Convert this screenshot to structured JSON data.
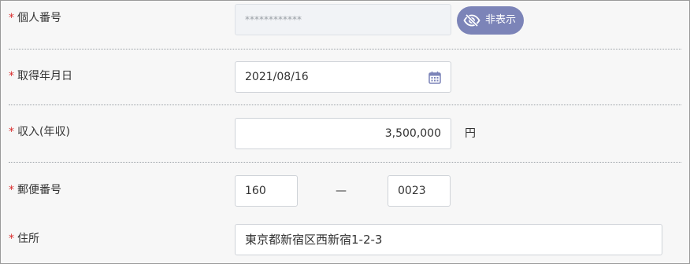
{
  "form": {
    "my_number": {
      "required_mark": "*",
      "label": "個人番号",
      "value": "************",
      "toggle_label": "非表示",
      "toggle_icon": "eye-slash-icon"
    },
    "acquired_date": {
      "required_mark": "*",
      "label": "取得年月日",
      "value": "2021/08/16",
      "icon": "calendar-icon"
    },
    "income": {
      "required_mark": "*",
      "label": "収入(年収)",
      "value": "3,500,000",
      "unit": "円"
    },
    "postal_code": {
      "required_mark": "*",
      "label": "郵便番号",
      "part1": "160",
      "separator": "—",
      "part2": "0023"
    },
    "address": {
      "required_mark": "*",
      "label": "住所",
      "value": "東京都新宿区西新宿1-2-3"
    }
  },
  "colors": {
    "required": "#d92b2b",
    "toggle_bg": "#7c84b8",
    "divider": "#9aa0a6"
  }
}
